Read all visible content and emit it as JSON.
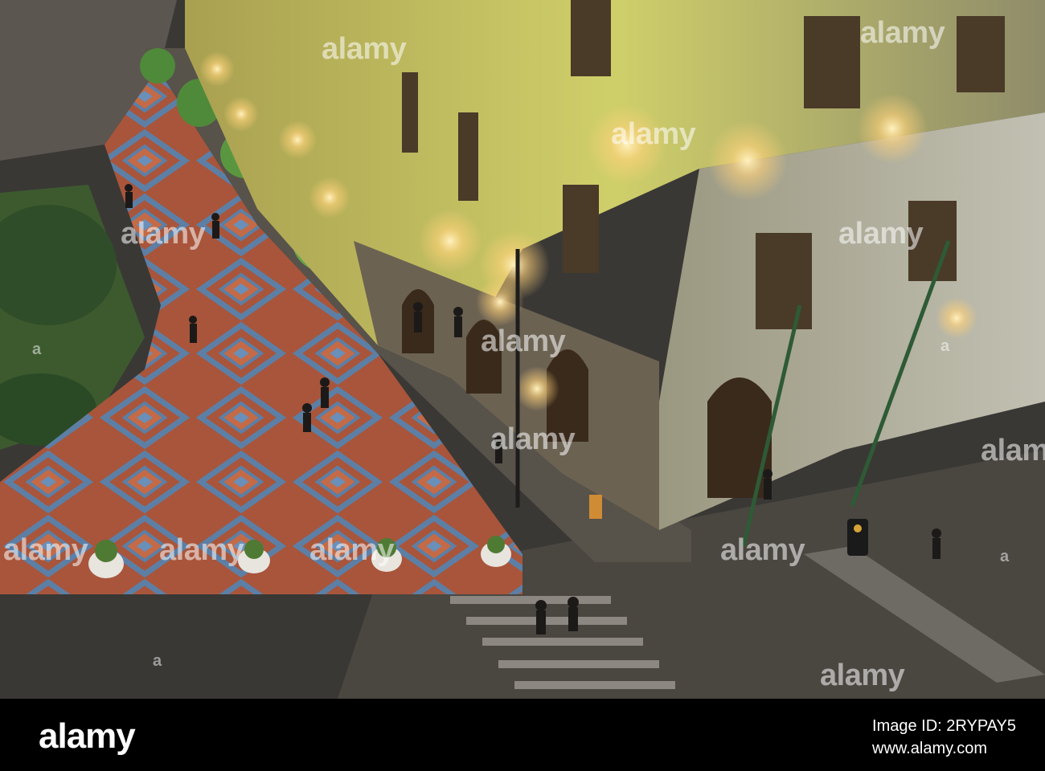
{
  "photo": {
    "subject": "aerial-night-plaza-with-colonial-building",
    "colors": {
      "plaza_orange": "#b0583a",
      "plaza_blue": "#5b7fa6",
      "facade_yellow": "#d8d86a",
      "street_dark": "#3a3835",
      "tree_green": "#4f8a3a",
      "lamp_glow": "#ffd27a"
    }
  },
  "watermark": {
    "text": "alamy",
    "small": "a"
  },
  "footer": {
    "logo": "alamy",
    "image_id_line": "Image ID: 2RYPAY5",
    "url": "www.alamy.com"
  }
}
